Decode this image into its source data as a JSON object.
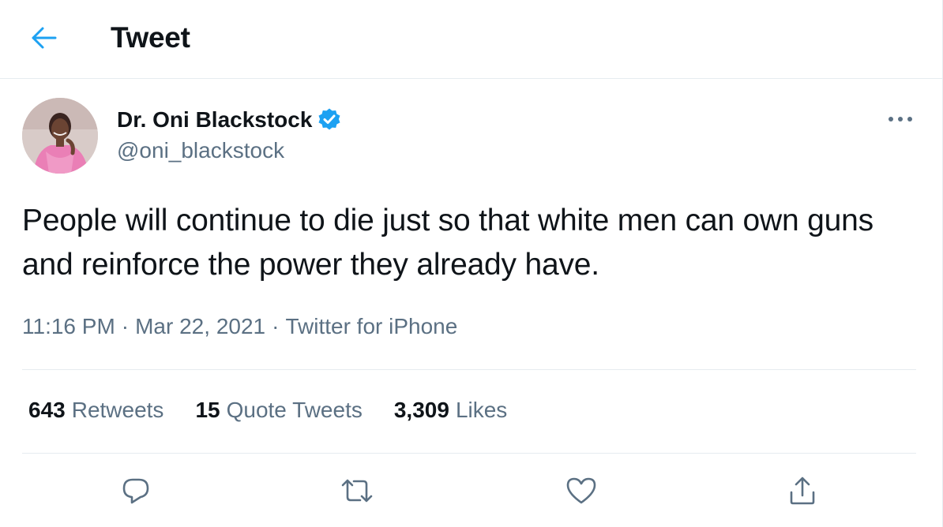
{
  "header": {
    "title": "Tweet",
    "back_icon": "arrow-left-icon"
  },
  "colors": {
    "accent": "#1da1f2",
    "secondary_text": "#5b7083",
    "primary_text": "#0f1419",
    "divider": "#e6ecf0"
  },
  "author": {
    "display_name": "Dr. Oni Blackstock",
    "handle": "@oni_blackstock",
    "verified_icon": "verified-badge-icon",
    "avatar_icon": "profile-photo"
  },
  "tweet": {
    "text": "People will continue to die just so that white men can own guns and reinforce the power they already have.",
    "time": "11:16 PM",
    "date": "Mar 22, 2021",
    "source": "Twitter for iPhone",
    "separator": "·"
  },
  "stats": {
    "retweets": {
      "count": "643",
      "label": "Retweets"
    },
    "quote_tweets": {
      "count": "15",
      "label": "Quote Tweets"
    },
    "likes": {
      "count": "3,309",
      "label": "Likes"
    }
  },
  "actions": {
    "reply_icon": "reply-icon",
    "retweet_icon": "retweet-icon",
    "like_icon": "heart-icon",
    "share_icon": "share-icon",
    "more_icon": "more-icon"
  }
}
